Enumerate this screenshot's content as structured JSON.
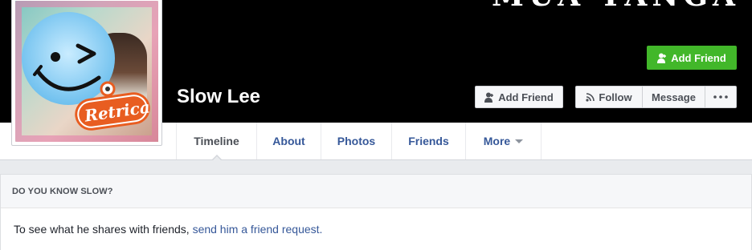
{
  "cover": {
    "text": "MUA TANGA"
  },
  "profile": {
    "name": "Slow Lee",
    "photo_watermark": "Retrica"
  },
  "actions": {
    "add_friend": "Add Friend",
    "follow": "Follow",
    "message": "Message",
    "more_icon": "ellipsis-icon"
  },
  "nav": {
    "tabs": [
      {
        "label": "Timeline",
        "active": true
      },
      {
        "label": "About"
      },
      {
        "label": "Photos"
      },
      {
        "label": "Friends"
      },
      {
        "label": "More"
      }
    ]
  },
  "know_card": {
    "title": "DO YOU KNOW SLOW?",
    "text": "To see what he shares with friends,",
    "link": "send him a friend request.",
    "button": "Add Friend"
  },
  "colors": {
    "cover_background": "#000000",
    "link_blue": "#365899",
    "green_button": "#42b72a",
    "page_background": "#e9ebee"
  }
}
